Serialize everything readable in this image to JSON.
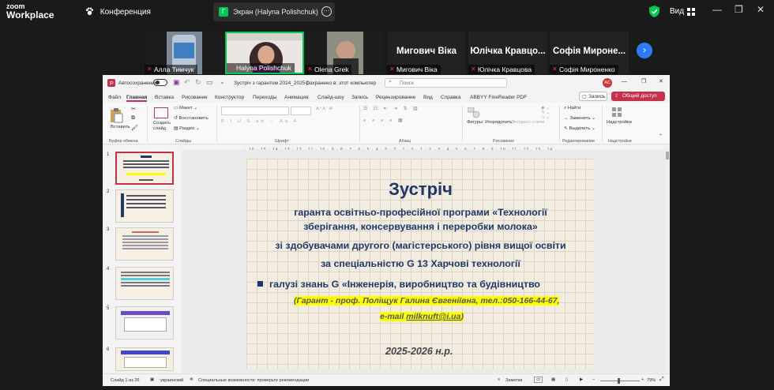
{
  "zoom": {
    "logo_line1": "zoom",
    "logo_line2": "Workplace",
    "conference_label": "Конференция",
    "share_label": "Экран (Halyna Polishchuk)",
    "share_badge": "Г",
    "view_label": "Вид",
    "window_controls": [
      "—",
      "❐",
      "✕"
    ]
  },
  "participants": [
    {
      "name": "Алла Тимчук",
      "type": "video"
    },
    {
      "name": "Halyna Polishchuk",
      "type": "video",
      "active": true
    },
    {
      "name": "Olena Grek",
      "type": "video"
    },
    {
      "name": "Мигович Віка",
      "big": "Мигович Віка",
      "type": "name"
    },
    {
      "name": "Юлічка Кравцова",
      "big": "Юлічка  Кравцо...",
      "type": "name"
    },
    {
      "name": "Софія Мироненко",
      "big": "Софія  Мироне...",
      "type": "name"
    }
  ],
  "ppt": {
    "autosave": "Автосохранение",
    "doc_title": "Зустріч з гарантом 2024_2025 р...",
    "save_state": "Сохранено в: этот компьютер",
    "search_placeholder": "Поиск",
    "avatar": "АС",
    "tabs": [
      "Файл",
      "Главная",
      "Вставка",
      "Рисование",
      "Конструктор",
      "Переходы",
      "Анимация",
      "Слайд-шоу",
      "Запись",
      "Рецензирование",
      "Вид",
      "Справка",
      "ABBYY FineReader PDF"
    ],
    "record_btn": "Запись",
    "share_btn": "Общий доступ",
    "ribbon": {
      "paste": "Вставить",
      "create_slide": "Создать слайд",
      "layout": "Макет",
      "reset": "Восстановить",
      "section": "Раздел",
      "shapes": "Фигуры",
      "arrange": "Упорядочить",
      "quick_styles": "Экспресс-стили",
      "find": "Найти",
      "replace": "Заменить",
      "select": "Выделить",
      "addins": "Надстройки",
      "groups": [
        "Буфер обмена",
        "Слайды",
        "Шрифт",
        "Абзац",
        "Рисование",
        "Редактирование",
        "Надстройки"
      ]
    },
    "ruler": "· 16 · 15 · 14 · 13 · 12 · 11 · 10 · 9 · 8 · 7 · 6 · 5 · 4 · 3 · 2 · 1 · 0 · 1 · 2 · 3 · 4 · 5 · 6 · 7 · 8 · 9 · 10 · 11 · 12 · 13 · 14 · 15 · 16",
    "thumb_numbers": [
      "1",
      "2",
      "3",
      "4",
      "5",
      "6"
    ],
    "slide": {
      "title": "Зустріч",
      "line1": "гаранта освітньо-професійної програми «Технології",
      "line2": "зберігання, консервування і переробки молока»",
      "line3": "зі здобувачами другого (магістерського) рівня вищої освіти",
      "line4": "за спеціальністю G 13 Харчові технології",
      "line5": "галузі знань G «Інженерія, виробництво та будівництво",
      "guarantor": "(Гарант - проф. Поліщук Галина Євгеніївна,  тел.:050-166-44-67,",
      "email_prefix": "e-mail ",
      "email": "milknuft@i.ua",
      "email_suffix": ")",
      "year": "2025-2026 н.р."
    },
    "status": {
      "slide_of": "Слайд 1 из 26",
      "language": "украинский",
      "accessibility": "Специальные возможности: проверьте рекомендации",
      "notes": "Заметки",
      "zoom": "79%"
    }
  },
  "colors": {
    "accent_green": "#00c853",
    "zoom_blue": "#2e7bf6",
    "ppt_red": "#c4314b",
    "slide_text": "#1f3869"
  }
}
